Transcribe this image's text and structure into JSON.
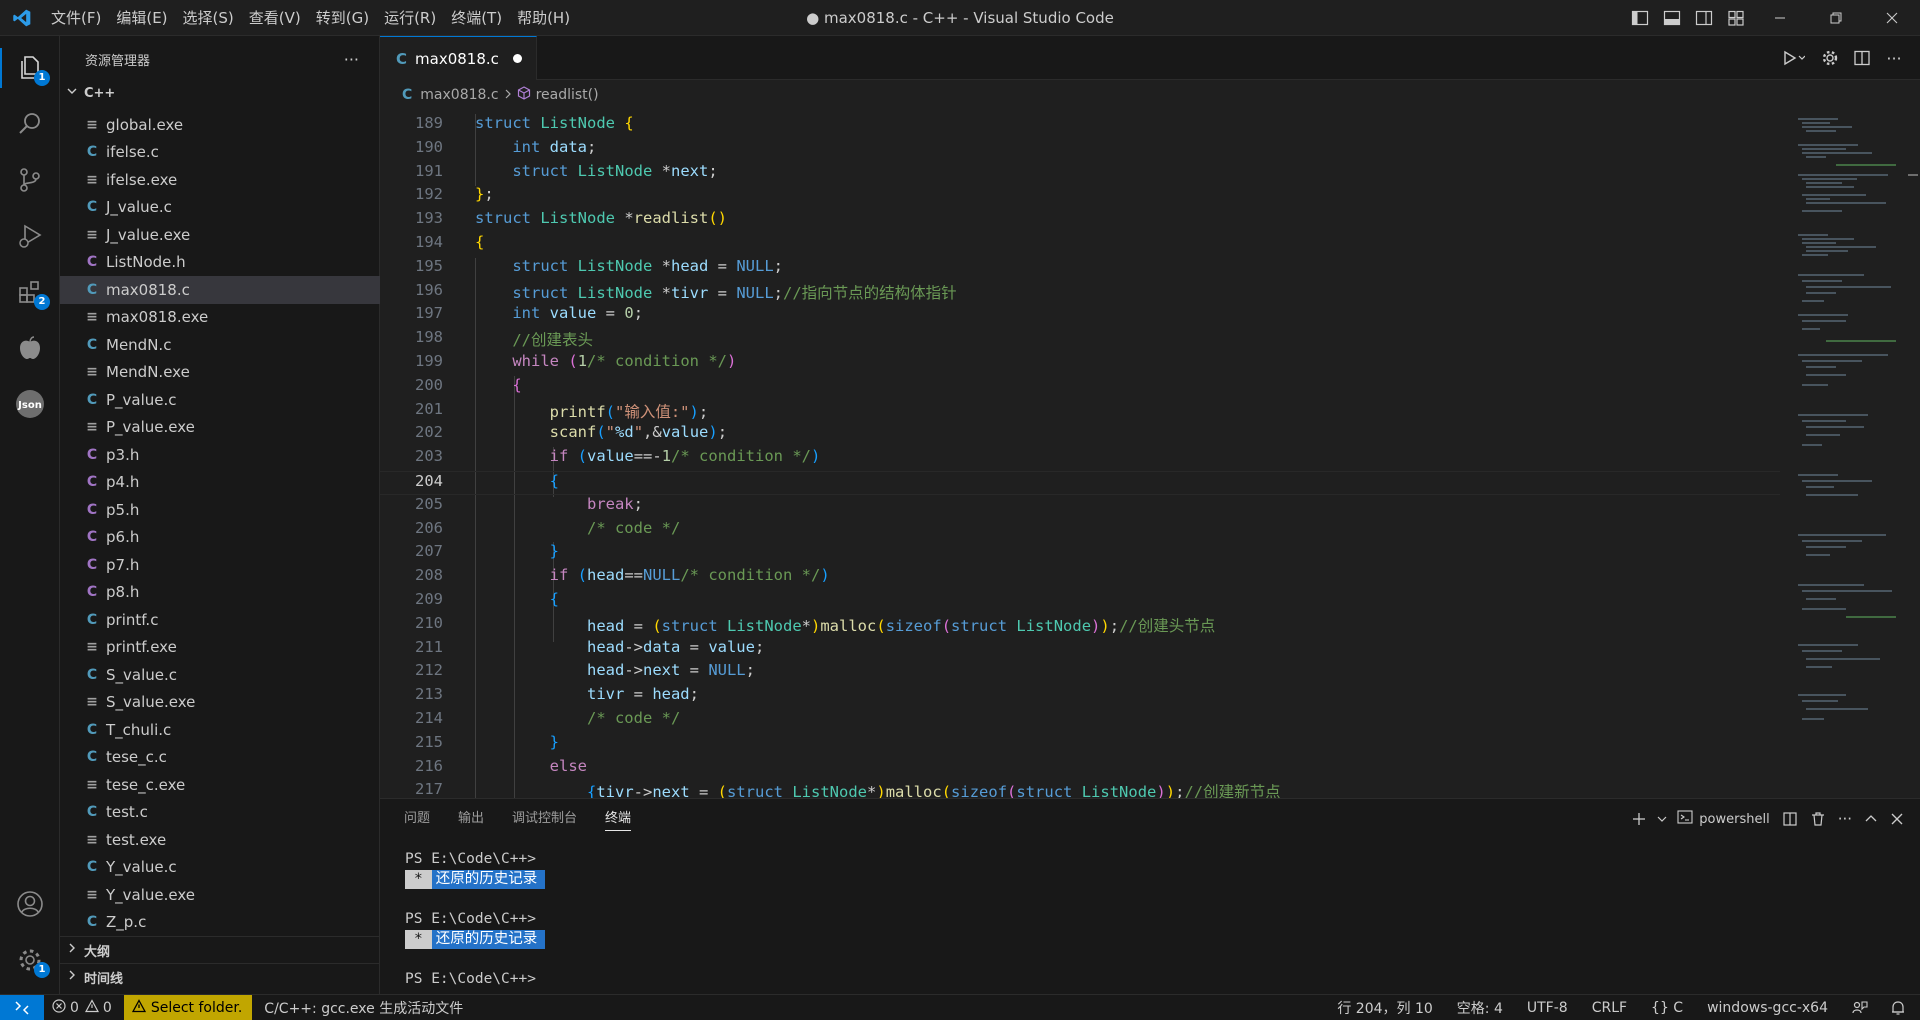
{
  "titlebar": {
    "menus": [
      "文件(F)",
      "编辑(E)",
      "选择(S)",
      "查看(V)",
      "转到(G)",
      "运行(R)",
      "终端(T)",
      "帮助(H)"
    ],
    "window_title": "● max0818.c - C++ - Visual Studio Code"
  },
  "activitybar": {
    "explorer_badge": "1",
    "extensions_badge": "2",
    "settings_badge": "1",
    "json_label": "Json"
  },
  "sidebar": {
    "title": "资源管理器",
    "more": "···",
    "folder": "C++",
    "files": [
      {
        "name": "global.exe",
        "type": "exe"
      },
      {
        "name": "ifelse.c",
        "type": "c"
      },
      {
        "name": "ifelse.exe",
        "type": "exe"
      },
      {
        "name": "J_value.c",
        "type": "c"
      },
      {
        "name": "J_value.exe",
        "type": "exe"
      },
      {
        "name": "ListNode.h",
        "type": "h"
      },
      {
        "name": "max0818.c",
        "type": "c",
        "selected": true
      },
      {
        "name": "max0818.exe",
        "type": "exe"
      },
      {
        "name": "MendN.c",
        "type": "c"
      },
      {
        "name": "MendN.exe",
        "type": "exe"
      },
      {
        "name": "P_value.c",
        "type": "c"
      },
      {
        "name": "P_value.exe",
        "type": "exe"
      },
      {
        "name": "p3.h",
        "type": "h"
      },
      {
        "name": "p4.h",
        "type": "h"
      },
      {
        "name": "p5.h",
        "type": "h"
      },
      {
        "name": "p6.h",
        "type": "h"
      },
      {
        "name": "p7.h",
        "type": "h"
      },
      {
        "name": "p8.h",
        "type": "h"
      },
      {
        "name": "printf.c",
        "type": "c"
      },
      {
        "name": "printf.exe",
        "type": "exe"
      },
      {
        "name": "S_value.c",
        "type": "c"
      },
      {
        "name": "S_value.exe",
        "type": "exe"
      },
      {
        "name": "T_chuli.c",
        "type": "c"
      },
      {
        "name": "tese_c.c",
        "type": "c"
      },
      {
        "name": "tese_c.exe",
        "type": "exe"
      },
      {
        "name": "test.c",
        "type": "c"
      },
      {
        "name": "test.exe",
        "type": "exe"
      },
      {
        "name": "Y_value.c",
        "type": "c"
      },
      {
        "name": "Y_value.exe",
        "type": "exe"
      },
      {
        "name": "Z_p.c",
        "type": "c"
      }
    ],
    "outline_label": "大纲",
    "timeline_label": "时间线"
  },
  "editor": {
    "tab_label": "max0818.c",
    "tab_icon": "C",
    "breadcrumb_file": "max0818.c",
    "breadcrumb_symbol": "readlist()",
    "current_line": "204",
    "line_numbers": [
      "189",
      "190",
      "191",
      "192",
      "193",
      "194",
      "195",
      "196",
      "197",
      "198",
      "199",
      "200",
      "201",
      "202",
      "203",
      "204",
      "205",
      "206",
      "207",
      "208",
      "209",
      "210",
      "211",
      "212",
      "213",
      "214",
      "215",
      "216",
      "217"
    ]
  },
  "panel": {
    "tabs": [
      "问题",
      "输出",
      "调试控制台",
      "终端"
    ],
    "active_tab": "终端",
    "shell": "powershell",
    "prompt": "PS E:\\Code\\C++>",
    "restore_star": "*",
    "restore_msg": "还原的历史记录"
  },
  "statusbar": {
    "errors": "0",
    "warnings": "0",
    "select_folder": "Select folder.",
    "build_task": "C/C++: gcc.exe 生成活动文件",
    "cursor": "行 204，列 10",
    "spaces": "空格: 4",
    "encoding": "UTF-8",
    "eol": "CRLF",
    "language": "{} C",
    "config": "windows-gcc-x64"
  },
  "colors": {
    "accent": "#0078d4",
    "warning_bg": "#c1a600",
    "terminal_selection": "#2472c8"
  }
}
